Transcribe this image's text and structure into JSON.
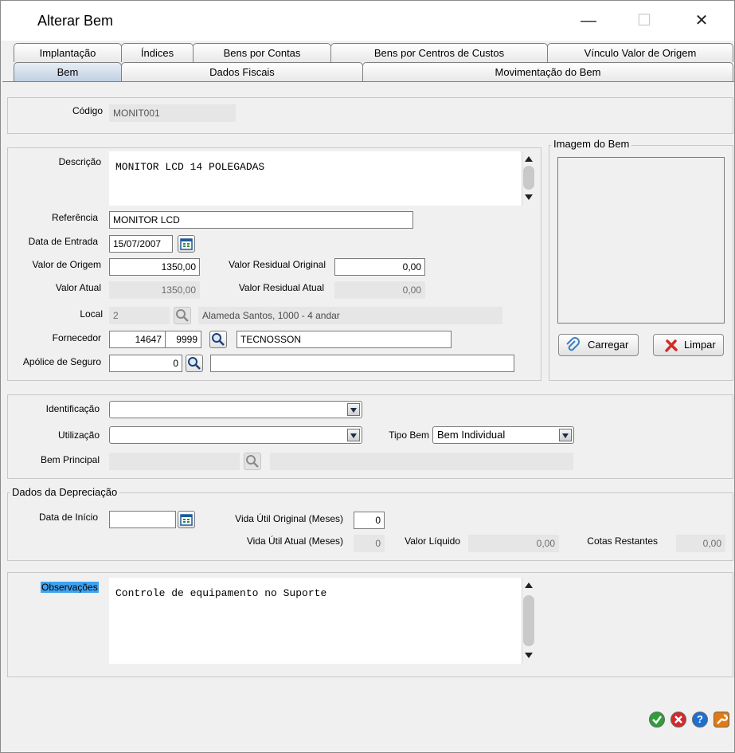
{
  "window": {
    "title": "Alterar Bem",
    "controls": {
      "minimize": "—",
      "maximize": "☐",
      "close": "✕"
    }
  },
  "tabs_row1": [
    "Implantação",
    "Índices",
    "Bens por Contas",
    "Bens por Centros de Custos",
    "Vínculo Valor de Origem"
  ],
  "tabs_row2": [
    "Bem",
    "Dados Fiscais",
    "Movimentação do Bem"
  ],
  "codigo": {
    "label": "Código",
    "value": "MONIT001"
  },
  "descricao": {
    "label": "Descrição",
    "value": "MONITOR LCD 14 POLEGADAS"
  },
  "referencia": {
    "label": "Referência",
    "value": "MONITOR LCD"
  },
  "data_entrada": {
    "label": "Data de Entrada",
    "value": "15/07/2007"
  },
  "valor_origem": {
    "label": "Valor de Origem",
    "value": "1350,00"
  },
  "valor_residual_original": {
    "label": "Valor Residual Original",
    "value": "0,00"
  },
  "valor_atual": {
    "label": "Valor Atual",
    "value": "1350,00"
  },
  "valor_residual_atual": {
    "label": "Valor Residual Atual",
    "value": "0,00"
  },
  "local": {
    "label": "Local",
    "code": "2",
    "description": "Alameda Santos, 1000 - 4 andar"
  },
  "fornecedor": {
    "label": "Fornecedor",
    "code": "14647",
    "store": "9999",
    "name": "TECNOSSON"
  },
  "apolice": {
    "label": "Apólice de Seguro",
    "value": "0",
    "description": ""
  },
  "imagem": {
    "legend": "Imagem do Bem",
    "load_label": "Carregar",
    "clear_label": "Limpar"
  },
  "identificacao": {
    "label": "Identificação",
    "value": ""
  },
  "utilizacao": {
    "label": "Utilização",
    "value": ""
  },
  "tipo_bem": {
    "label": "Tipo Bem",
    "value": "Bem Individual"
  },
  "bem_principal": {
    "label": "Bem Principal",
    "code": "",
    "description": ""
  },
  "depreciacao": {
    "legend": "Dados da Depreciação",
    "data_inicio_label": "Data de Início",
    "data_inicio": "",
    "vida_util_original_label": "Vida Útil Original (Meses)",
    "vida_util_original": "0",
    "vida_util_atual_label": "Vida Útil Atual (Meses)",
    "vida_util_atual": "0",
    "valor_liquido_label": "Valor Líquido",
    "valor_liquido": "0,00",
    "cotas_restantes_label": "Cotas Restantes",
    "cotas_restantes": "0,00"
  },
  "observacoes": {
    "label": "Observações",
    "value": "Controle de equipamento no Suporte"
  },
  "colors": {
    "accent": "#c0cfe2",
    "ok": "#2e9e3b",
    "cancel": "#d42a2a",
    "help": "#1e6fd0",
    "tools": "#e07b14"
  },
  "icons": {
    "ok": "check-icon",
    "cancel": "close-icon",
    "help": "help-icon",
    "tools": "wrench-icon",
    "calendar": "calendar-icon",
    "search": "magnifier-icon",
    "clip": "paperclip-icon",
    "clear": "red-x-icon"
  }
}
